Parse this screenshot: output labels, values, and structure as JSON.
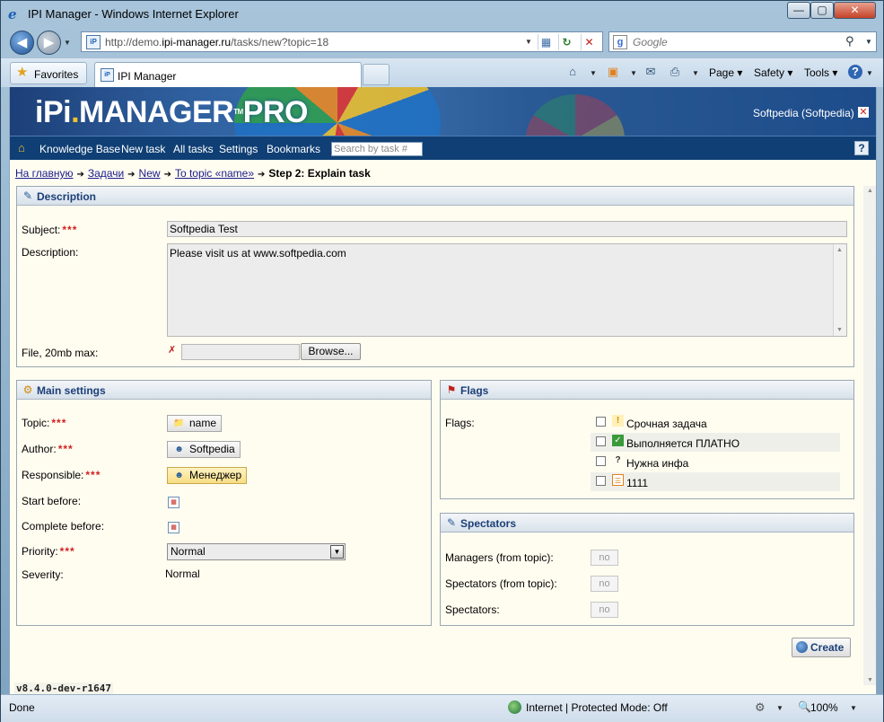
{
  "window": {
    "title": "IPI Manager - Windows Internet Explorer",
    "min": "—",
    "max": "▢",
    "close": "✕"
  },
  "address": {
    "url_prefix": "http://demo.",
    "url_domain": "ipi-manager.ru",
    "url_path": "/tasks/new?topic=18",
    "search_placeholder": "Google"
  },
  "tabs": {
    "favorites": "Favorites",
    "active_tab": "IPI Manager"
  },
  "commandbar": {
    "page": "Page",
    "safety": "Safety",
    "tools": "Tools"
  },
  "banner": {
    "logo_ipi": "iPi",
    "logo_dot": ".",
    "logo_manager": "MANAGER",
    "logo_tm": "TM",
    "logo_pro": "PRO",
    "user": "Softpedia (Softpedia)"
  },
  "nav": {
    "items": [
      "Knowledge Base",
      "New task",
      "All tasks",
      "Settings",
      "Bookmarks"
    ],
    "search_placeholder": "Search by task #"
  },
  "breadcrumb": {
    "home": "На главную",
    "tasks": "Задачи",
    "new": "New",
    "topic": "To topic «name»",
    "current": "Step 2: Explain task"
  },
  "description_panel": {
    "title": "Description",
    "subject_label": "Subject:",
    "required": "***",
    "subject_value": "Softpedia Test",
    "description_label": "Description:",
    "description_value": "Please visit us at www.softpedia.com",
    "file_label": "File, 20mb max:",
    "browse": "Browse..."
  },
  "main_settings": {
    "title": "Main settings",
    "topic_label": "Topic:",
    "topic_value": "name",
    "author_label": "Author:",
    "author_value": "Softpedia",
    "responsible_label": "Responsible:",
    "responsible_value": "Менеджер",
    "start_label": "Start before:",
    "complete_label": "Complete before:",
    "priority_label": "Priority:",
    "priority_value": "Normal",
    "severity_label": "Severity:",
    "severity_value": "Normal"
  },
  "flags_panel": {
    "title": "Flags",
    "flags_label": "Flags:",
    "items": [
      {
        "label": "Срочная задача",
        "icon": "urgent-icon",
        "checked": false
      },
      {
        "label": "Выполняется ПЛАТНО",
        "icon": "paid-check-icon",
        "checked": false
      },
      {
        "label": "Нужна инфа",
        "icon": "question-icon",
        "checked": false
      },
      {
        "label": "1111",
        "icon": "note-icon",
        "checked": false
      }
    ]
  },
  "spectators_panel": {
    "title": "Spectators",
    "managers_label": "Managers (from topic):",
    "spectators_topic_label": "Spectators (from topic):",
    "spectators_label": "Spectators:",
    "no": "no"
  },
  "actions": {
    "create": "Create"
  },
  "version": "v8.4.0-dev-r1647",
  "status": {
    "text": "Done",
    "zone": "Internet | Protected Mode: Off",
    "zoom": "100%"
  }
}
